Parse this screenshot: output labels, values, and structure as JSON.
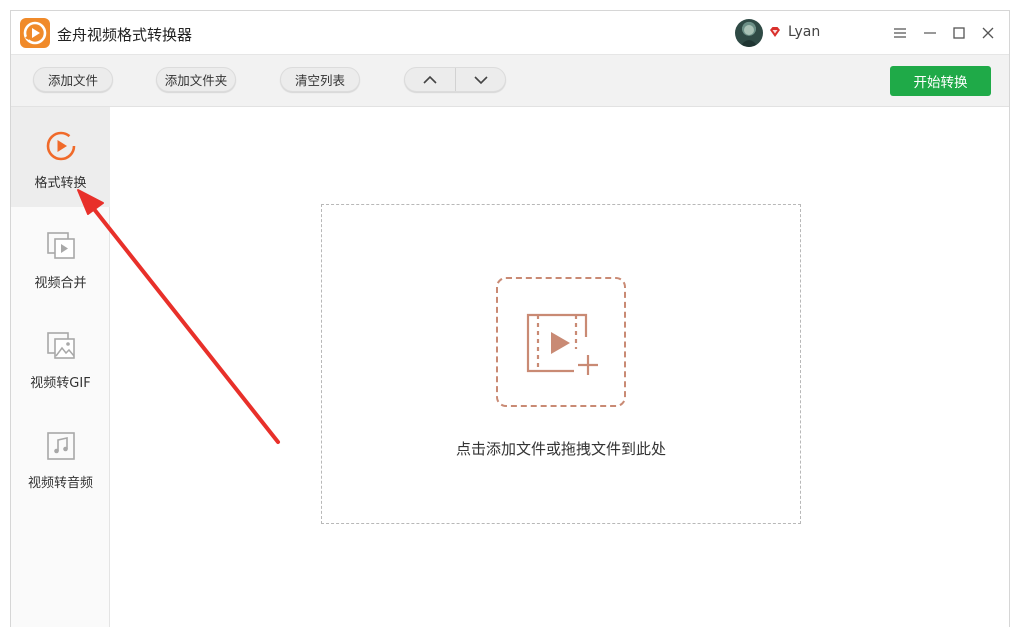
{
  "app": {
    "title": "金舟视频格式转换器",
    "logo_icon": "play-refresh-icon",
    "accent": "#f08a2a"
  },
  "user": {
    "name": "Lyan",
    "vip_icon": "vip-diamond-icon",
    "vip_color": "#d9302c"
  },
  "window_controls": [
    "menu-icon",
    "minimize-icon",
    "maximize-icon",
    "close-icon"
  ],
  "toolbar": {
    "add_file": "添加文件",
    "add_folder": "添加文件夹",
    "clear_list": "清空列表",
    "move_up_icon": "chevron-up-icon",
    "move_down_icon": "chevron-down-icon",
    "start": "开始转换",
    "start_color": "#1faa48"
  },
  "sidebar": {
    "items": [
      {
        "label": "格式转换",
        "icon": "format-convert-icon",
        "active": true
      },
      {
        "label": "视频合并",
        "icon": "video-merge-icon",
        "active": false
      },
      {
        "label": "视频转GIF",
        "icon": "video-to-gif-icon",
        "active": false
      },
      {
        "label": "视频转音频",
        "icon": "video-to-audio-icon",
        "active": false
      }
    ]
  },
  "main": {
    "drop_text": "点击添加文件或拖拽文件到此处",
    "drop_icon": "add-video-icon",
    "drop_icon_color": "#c98a74"
  },
  "annotation": {
    "arrow_color": "#e8302a"
  }
}
